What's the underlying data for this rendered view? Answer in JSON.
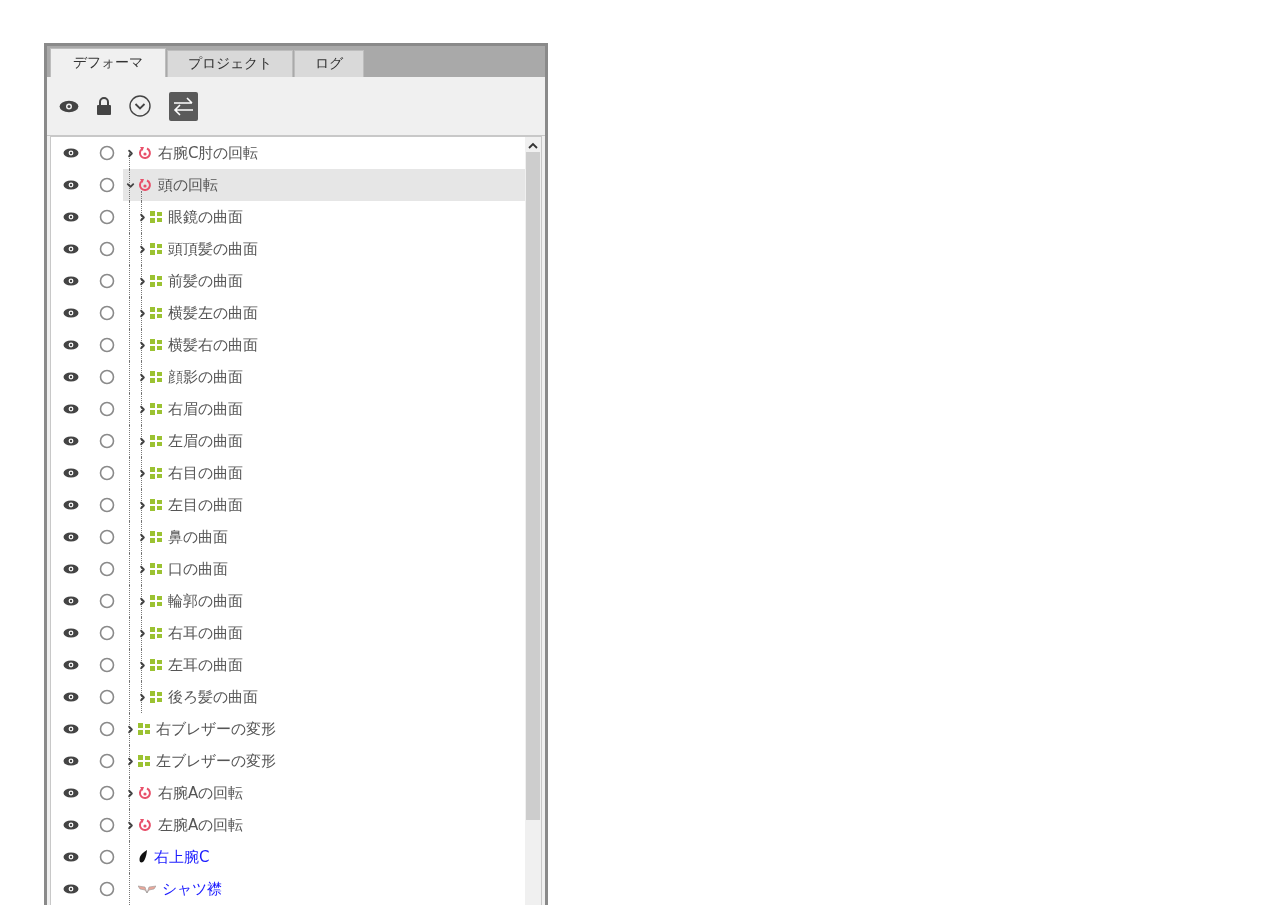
{
  "tabs": [
    {
      "label": "デフォーマ",
      "selected": true
    },
    {
      "label": "プロジェクト",
      "selected": false
    },
    {
      "label": "ログ",
      "selected": false
    }
  ],
  "tree": [
    {
      "kind": "rotation",
      "label": "右腕C肘の回転",
      "expanded": false,
      "selected": false
    },
    {
      "kind": "rotation",
      "label": "頭の回転",
      "expanded": true,
      "selected": true,
      "children": [
        {
          "kind": "warp",
          "label": "眼鏡の曲面",
          "expanded": false,
          "selected": false
        },
        {
          "kind": "warp",
          "label": "頭頂髪の曲面",
          "expanded": false,
          "selected": false
        },
        {
          "kind": "warp",
          "label": "前髪の曲面",
          "expanded": false,
          "selected": false
        },
        {
          "kind": "warp",
          "label": "横髪左の曲面",
          "expanded": false,
          "selected": false
        },
        {
          "kind": "warp",
          "label": "横髪右の曲面",
          "expanded": false,
          "selected": false
        },
        {
          "kind": "warp",
          "label": "顔影の曲面",
          "expanded": false,
          "selected": false
        },
        {
          "kind": "warp",
          "label": "右眉の曲面",
          "expanded": false,
          "selected": false
        },
        {
          "kind": "warp",
          "label": "左眉の曲面",
          "expanded": false,
          "selected": false
        },
        {
          "kind": "warp",
          "label": "右目の曲面",
          "expanded": false,
          "selected": false
        },
        {
          "kind": "warp",
          "label": "左目の曲面",
          "expanded": false,
          "selected": false
        },
        {
          "kind": "warp",
          "label": "鼻の曲面",
          "expanded": false,
          "selected": false
        },
        {
          "kind": "warp",
          "label": "口の曲面",
          "expanded": false,
          "selected": false
        },
        {
          "kind": "warp",
          "label": "輪郭の曲面",
          "expanded": false,
          "selected": false
        },
        {
          "kind": "warp",
          "label": "右耳の曲面",
          "expanded": false,
          "selected": false
        },
        {
          "kind": "warp",
          "label": "左耳の曲面",
          "expanded": false,
          "selected": false
        },
        {
          "kind": "warp",
          "label": "後ろ髪の曲面",
          "expanded": false,
          "selected": false
        }
      ]
    },
    {
      "kind": "warp",
      "label": "右ブレザーの変形",
      "expanded": false,
      "selected": false
    },
    {
      "kind": "warp",
      "label": "左ブレザーの変形",
      "expanded": false,
      "selected": false
    },
    {
      "kind": "rotation",
      "label": "右腕Aの回転",
      "expanded": false,
      "selected": false
    },
    {
      "kind": "rotation",
      "label": "左腕Aの回転",
      "expanded": false,
      "selected": false
    },
    {
      "kind": "artmesh",
      "label": "右上腕C",
      "selected": false
    },
    {
      "kind": "artmesh_textured",
      "label": "シャツ襟",
      "selected": false
    }
  ]
}
